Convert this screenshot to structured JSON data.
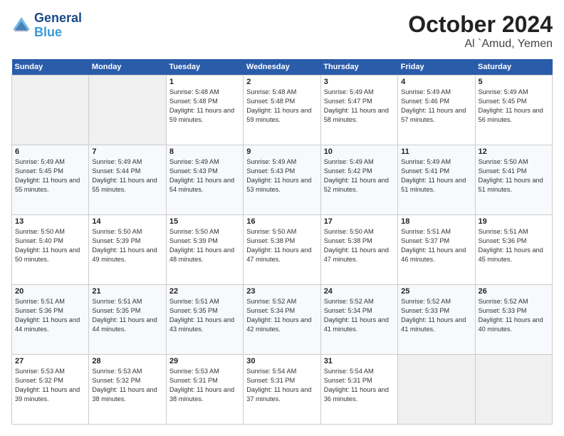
{
  "header": {
    "logo_line1": "General",
    "logo_line2": "Blue",
    "title": "October 2024",
    "subtitle": "Al `Amud, Yemen"
  },
  "weekdays": [
    "Sunday",
    "Monday",
    "Tuesday",
    "Wednesday",
    "Thursday",
    "Friday",
    "Saturday"
  ],
  "weeks": [
    [
      {
        "day": "",
        "info": ""
      },
      {
        "day": "",
        "info": ""
      },
      {
        "day": "1",
        "info": "Sunrise: 5:48 AM\nSunset: 5:48 PM\nDaylight: 11 hours and 59 minutes."
      },
      {
        "day": "2",
        "info": "Sunrise: 5:48 AM\nSunset: 5:48 PM\nDaylight: 11 hours and 59 minutes."
      },
      {
        "day": "3",
        "info": "Sunrise: 5:49 AM\nSunset: 5:47 PM\nDaylight: 11 hours and 58 minutes."
      },
      {
        "day": "4",
        "info": "Sunrise: 5:49 AM\nSunset: 5:46 PM\nDaylight: 11 hours and 57 minutes."
      },
      {
        "day": "5",
        "info": "Sunrise: 5:49 AM\nSunset: 5:45 PM\nDaylight: 11 hours and 56 minutes."
      }
    ],
    [
      {
        "day": "6",
        "info": "Sunrise: 5:49 AM\nSunset: 5:45 PM\nDaylight: 11 hours and 55 minutes."
      },
      {
        "day": "7",
        "info": "Sunrise: 5:49 AM\nSunset: 5:44 PM\nDaylight: 11 hours and 55 minutes."
      },
      {
        "day": "8",
        "info": "Sunrise: 5:49 AM\nSunset: 5:43 PM\nDaylight: 11 hours and 54 minutes."
      },
      {
        "day": "9",
        "info": "Sunrise: 5:49 AM\nSunset: 5:43 PM\nDaylight: 11 hours and 53 minutes."
      },
      {
        "day": "10",
        "info": "Sunrise: 5:49 AM\nSunset: 5:42 PM\nDaylight: 11 hours and 52 minutes."
      },
      {
        "day": "11",
        "info": "Sunrise: 5:49 AM\nSunset: 5:41 PM\nDaylight: 11 hours and 51 minutes."
      },
      {
        "day": "12",
        "info": "Sunrise: 5:50 AM\nSunset: 5:41 PM\nDaylight: 11 hours and 51 minutes."
      }
    ],
    [
      {
        "day": "13",
        "info": "Sunrise: 5:50 AM\nSunset: 5:40 PM\nDaylight: 11 hours and 50 minutes."
      },
      {
        "day": "14",
        "info": "Sunrise: 5:50 AM\nSunset: 5:39 PM\nDaylight: 11 hours and 49 minutes."
      },
      {
        "day": "15",
        "info": "Sunrise: 5:50 AM\nSunset: 5:39 PM\nDaylight: 11 hours and 48 minutes."
      },
      {
        "day": "16",
        "info": "Sunrise: 5:50 AM\nSunset: 5:38 PM\nDaylight: 11 hours and 47 minutes."
      },
      {
        "day": "17",
        "info": "Sunrise: 5:50 AM\nSunset: 5:38 PM\nDaylight: 11 hours and 47 minutes."
      },
      {
        "day": "18",
        "info": "Sunrise: 5:51 AM\nSunset: 5:37 PM\nDaylight: 11 hours and 46 minutes."
      },
      {
        "day": "19",
        "info": "Sunrise: 5:51 AM\nSunset: 5:36 PM\nDaylight: 11 hours and 45 minutes."
      }
    ],
    [
      {
        "day": "20",
        "info": "Sunrise: 5:51 AM\nSunset: 5:36 PM\nDaylight: 11 hours and 44 minutes."
      },
      {
        "day": "21",
        "info": "Sunrise: 5:51 AM\nSunset: 5:35 PM\nDaylight: 11 hours and 44 minutes."
      },
      {
        "day": "22",
        "info": "Sunrise: 5:51 AM\nSunset: 5:35 PM\nDaylight: 11 hours and 43 minutes."
      },
      {
        "day": "23",
        "info": "Sunrise: 5:52 AM\nSunset: 5:34 PM\nDaylight: 11 hours and 42 minutes."
      },
      {
        "day": "24",
        "info": "Sunrise: 5:52 AM\nSunset: 5:34 PM\nDaylight: 11 hours and 41 minutes."
      },
      {
        "day": "25",
        "info": "Sunrise: 5:52 AM\nSunset: 5:33 PM\nDaylight: 11 hours and 41 minutes."
      },
      {
        "day": "26",
        "info": "Sunrise: 5:52 AM\nSunset: 5:33 PM\nDaylight: 11 hours and 40 minutes."
      }
    ],
    [
      {
        "day": "27",
        "info": "Sunrise: 5:53 AM\nSunset: 5:32 PM\nDaylight: 11 hours and 39 minutes."
      },
      {
        "day": "28",
        "info": "Sunrise: 5:53 AM\nSunset: 5:32 PM\nDaylight: 11 hours and 38 minutes."
      },
      {
        "day": "29",
        "info": "Sunrise: 5:53 AM\nSunset: 5:31 PM\nDaylight: 11 hours and 38 minutes."
      },
      {
        "day": "30",
        "info": "Sunrise: 5:54 AM\nSunset: 5:31 PM\nDaylight: 11 hours and 37 minutes."
      },
      {
        "day": "31",
        "info": "Sunrise: 5:54 AM\nSunset: 5:31 PM\nDaylight: 11 hours and 36 minutes."
      },
      {
        "day": "",
        "info": ""
      },
      {
        "day": "",
        "info": ""
      }
    ]
  ]
}
